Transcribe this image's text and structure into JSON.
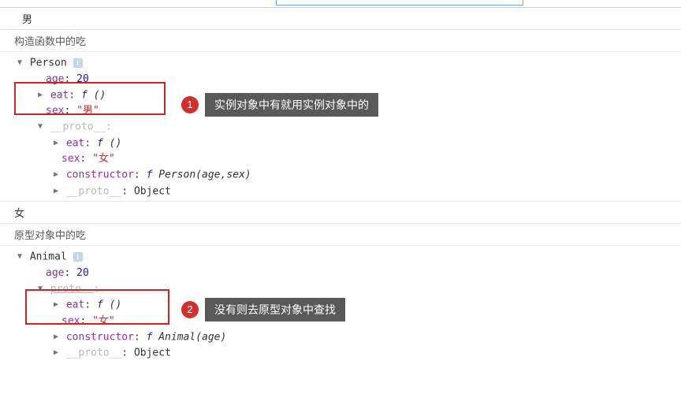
{
  "log1": "男",
  "section1_title": "构造函数中的吃",
  "log2": "女",
  "section2_title": "原型对象中的吃",
  "obj1": {
    "class_name": "Person",
    "age_key": "age",
    "age_val": "20",
    "eat_key": "eat",
    "eat_val_sig": " ()",
    "sex_key": "sex",
    "sex_val": "\"男\"",
    "proto_key": "__proto__",
    "proto": {
      "eat_key": "eat",
      "eat_sig": " ()",
      "sex_key": "sex",
      "sex_val": "\"女\"",
      "ctor_key": "constructor",
      "ctor_sig": " Person(age,sex)",
      "proto_key": "__proto__",
      "proto_val": "Object"
    }
  },
  "obj2": {
    "class_name": "Animal",
    "age_key": "age",
    "age_val": "20",
    "proto_key": "proto",
    "proto": {
      "eat_key": "eat",
      "eat_sig": " ()",
      "sex_key": "sex",
      "sex_val": "\"女\"",
      "ctor_key": "constructor",
      "ctor_sig": " Animal(age)",
      "proto_key": "__proto__",
      "proto_val": "Object"
    }
  },
  "annotation1": {
    "num": "1",
    "text": "实例对象中有就用实例对象中的"
  },
  "annotation2": {
    "num": "2",
    "text": "没有则去原型对象中查找"
  }
}
